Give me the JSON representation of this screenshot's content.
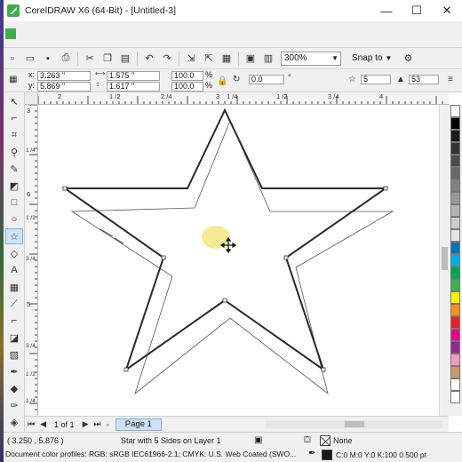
{
  "window": {
    "title": "CorelDRAW X6 (64-Bit) - [Untitled-3]",
    "minimize": "—",
    "maximize": "☐",
    "close": "✕"
  },
  "toolbar": {
    "zoom_value": "300%",
    "snap_label": "Snap to",
    "icons": [
      "new-document-icon",
      "open-icon",
      "save-icon",
      "print-icon",
      "cut-icon",
      "copy-icon",
      "paste-icon",
      "undo-icon",
      "redo-icon",
      "import-icon",
      "export-icon",
      "publish-pdf-icon",
      "zoom-dropdown",
      "snap-to-dropdown",
      "settings-icon"
    ]
  },
  "property_bar": {
    "x_label": "x:",
    "x_value": "3.263 \"",
    "y_label": "y:",
    "y_value": "5.869 \"",
    "width_value": "1.575 \"",
    "height_value": "1.617 \"",
    "scale_w": "100.0",
    "scale_h": "100.0",
    "percent": "%",
    "rotation_value": "0.0",
    "degree": "°",
    "points_value": "5",
    "sharpness_value": "53"
  },
  "rulers": {
    "h_labels": [
      "2",
      "1 /2",
      "2 /4",
      "3",
      "1 /4",
      "1 /2",
      "3 /4",
      "4"
    ],
    "units": "inches",
    "v_labels": [
      "3",
      "1 /4",
      "6",
      "1 /2",
      "3 /4",
      "5",
      "3 /4",
      "1 /2",
      "1 /4",
      "5"
    ],
    "v_units": "inches"
  },
  "pagebar": {
    "page_counter": "1 of 1",
    "page_tab": "Page 1"
  },
  "status": {
    "cursor_coords": "( 3.250 , 5.876 )",
    "selection_info": "Star with 5 Sides on Layer 1",
    "color_profiles": "Document color profiles: RGB: sRGB IEC61966-2.1; CMYK: U.S. Web Coated (SWO...",
    "fill_label": "None",
    "outline_label": "C:0 M:0 Y:0 K:100  0.500 pt"
  },
  "palette_colors": [
    "#ffffff",
    "#000000",
    "#1a1a1a",
    "#333333",
    "#4d4d4d",
    "#666666",
    "#808080",
    "#999999",
    "#b3b3b3",
    "#cccccc",
    "#e6e6e6",
    "#0072bc",
    "#00aeef",
    "#00a651",
    "#39b54a",
    "#fff200",
    "#f7941d",
    "#ed1c24",
    "#ec008c",
    "#92278f",
    "#f49ac1",
    "#c69c6d",
    "#ffffff",
    "#ffffff"
  ],
  "colors": {
    "chrome": "#f0f0f0",
    "accent": "#3fae49",
    "highlight_cursor": "#f5ea8c"
  }
}
